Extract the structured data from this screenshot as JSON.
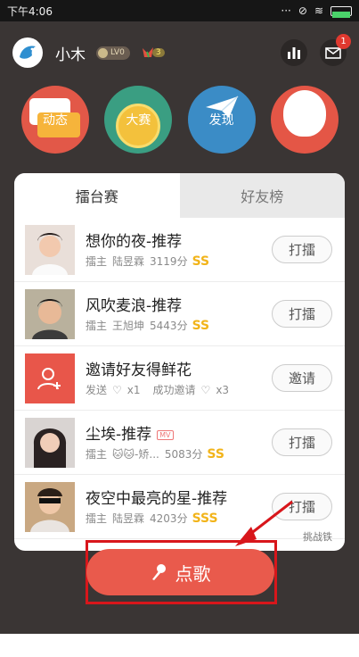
{
  "status_bar": {
    "time": "下午4:06"
  },
  "profile": {
    "name": "小木",
    "level": "LV0",
    "flowers": "3",
    "notifications": "1"
  },
  "menu": [
    {
      "label": "动态"
    },
    {
      "label": "大赛"
    },
    {
      "label": "发现"
    },
    {
      "label": "我的"
    }
  ],
  "tabs": [
    {
      "label": "擂台赛",
      "active": true
    },
    {
      "label": "好友榜",
      "active": false
    }
  ],
  "rows": [
    {
      "title": "想你的夜-推荐",
      "role": "擂主",
      "owner": "陆昱霖",
      "score": "3119分",
      "grade": "SS",
      "action": "打擂"
    },
    {
      "title": "风吹麦浪-推荐",
      "role": "擂主",
      "owner": "王旭坤",
      "score": "5443分",
      "grade": "SS",
      "action": "打擂"
    },
    {
      "title": "邀请好友得鲜花",
      "send_label": "发送",
      "send_count": "x1",
      "success_label": "成功邀请",
      "success_count": "x3",
      "action": "邀请"
    },
    {
      "title": "尘埃-推荐",
      "mv": "MV",
      "role": "擂主",
      "owner": "-矫...",
      "score": "5083分",
      "grade": "SS",
      "action": "打擂"
    },
    {
      "title": "夜空中最亮的星-推荐",
      "role": "擂主",
      "owner": "陆昱霖",
      "score": "4203分",
      "grade": "SSS",
      "action": "打擂"
    }
  ],
  "footer_note": "挑战铁",
  "song_button": "点歌",
  "colors": {
    "accent": "#e95a4c",
    "grade": "#f2b41a",
    "highlight_box": "#d8161b"
  }
}
